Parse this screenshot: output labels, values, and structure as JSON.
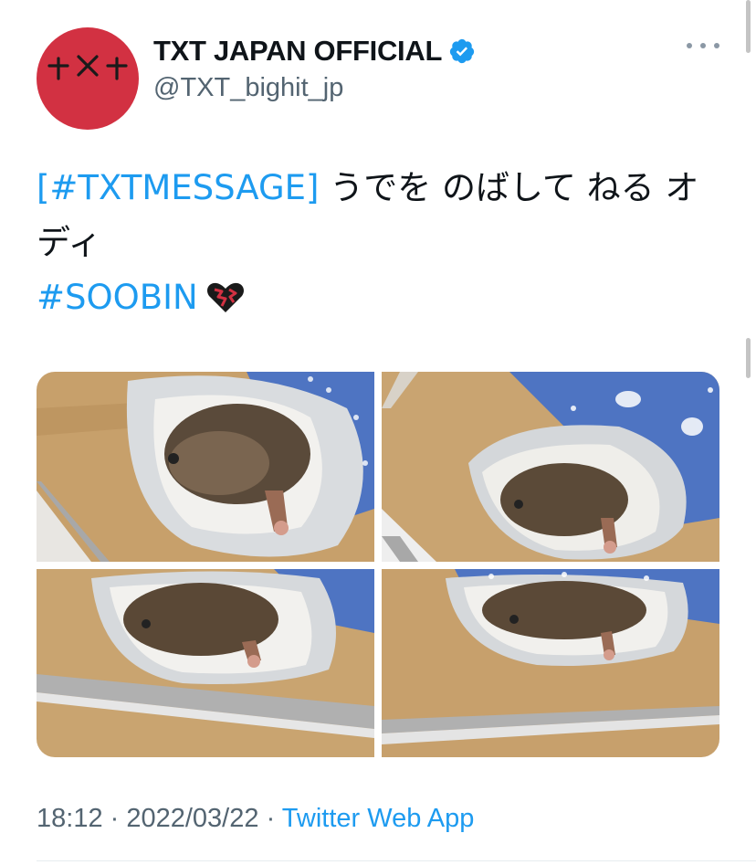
{
  "author": {
    "display_name": "TXT JAPAN OFFICIAL",
    "handle": "@TXT_bighit_jp",
    "verified_icon": "verified-badge-icon",
    "avatar_icon": "txt-logo-icon"
  },
  "more_icon": "more-dots-icon",
  "tweet": {
    "hashtag1": "[#TXTMESSAGE]",
    "text_part": " うでを のばして ねる オディ",
    "hashtag2": "#SOOBIN",
    "emoji_icon": "broken-heart-emoji-icon"
  },
  "media": {
    "photos": [
      "hedgehog-photo",
      "hedgehog-photo",
      "hedgehog-photo",
      "hedgehog-photo"
    ]
  },
  "footer": {
    "time": "18:12",
    "sep1": " · ",
    "date": "2022/03/22",
    "sep2": " · ",
    "app": "Twitter Web App"
  },
  "colors": {
    "link": "#1d9bf0",
    "avatar_bg": "#d23142",
    "secondary_text": "#536471"
  }
}
